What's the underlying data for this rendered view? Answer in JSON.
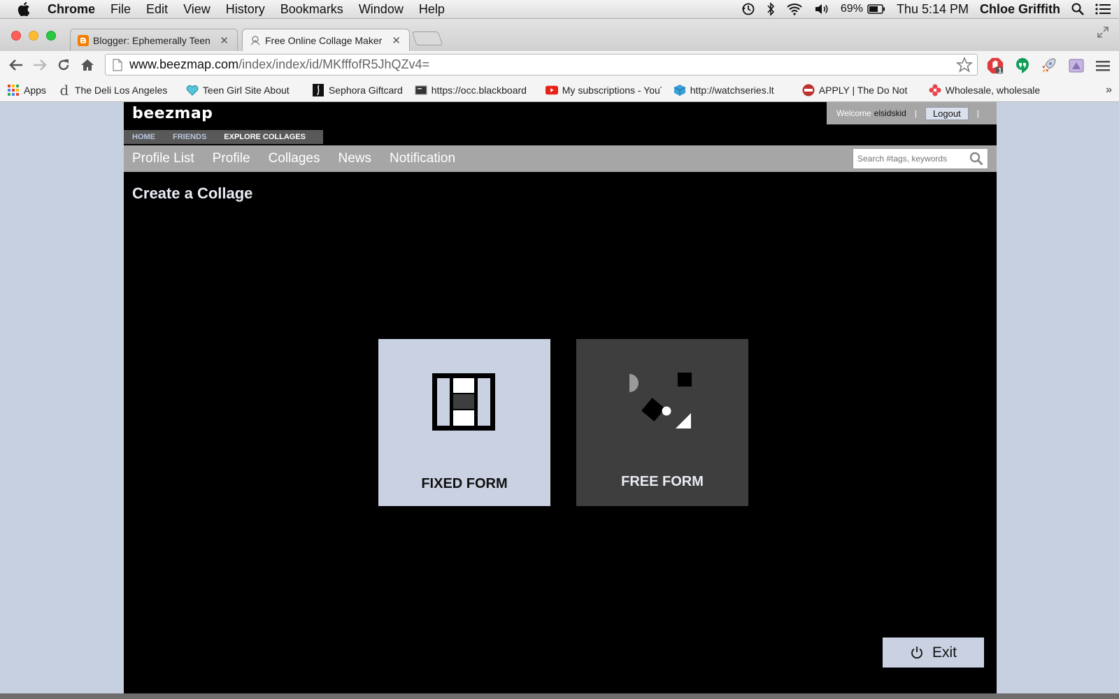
{
  "menubar": {
    "app_name": "Chrome",
    "items": [
      "File",
      "Edit",
      "View",
      "History",
      "Bookmarks",
      "Window",
      "Help"
    ],
    "battery": "69%",
    "clock": "Thu 5:14 PM",
    "user": "Chloe Griffith"
  },
  "tabs": [
    {
      "title": "Blogger: Ephemerally Teen",
      "icon": "blogger-icon",
      "active": false
    },
    {
      "title": "Free Online Collage Maker",
      "icon": "beezmap-icon",
      "active": true
    }
  ],
  "toolbar": {
    "url_host": "www.beezmap.com",
    "url_path": "/index/index/id/MKfffofR5JhQZv4=",
    "extension_badge": "1"
  },
  "bookmarks": [
    {
      "label": "Apps",
      "icon": "apps-grid-icon"
    },
    {
      "label": "The Deli Los Angeles",
      "icon": "deli-icon"
    },
    {
      "label": "Teen Girl Site About",
      "icon": "heart-icon"
    },
    {
      "label": "Sephora Giftcard",
      "icon": "sephora-icon"
    },
    {
      "label": "https://occ.blackboard",
      "icon": "blackboard-icon"
    },
    {
      "label": "My subscriptions - YouTube",
      "icon": "youtube-icon"
    },
    {
      "label": "http://watchseries.lt",
      "icon": "cube-icon"
    },
    {
      "label": "APPLY | The Do Not",
      "icon": "apply-icon"
    },
    {
      "label": "Wholesale, wholesale",
      "icon": "flower-icon"
    }
  ],
  "site": {
    "brand": "beezmap",
    "welcome_label": "Welcome",
    "username": "elsidskid",
    "logout_label": "Logout",
    "top_nav": [
      "HOME",
      "FRIENDS",
      "EXPLORE COLLAGES"
    ],
    "sub_nav": [
      "Profile List",
      "Profile",
      "Collages",
      "News",
      "Notification"
    ],
    "search_placeholder": "Search #tags, keywords",
    "page_title": "Create a Collage",
    "fixed_form_label": "FIXED FORM",
    "free_form_label": "FREE FORM",
    "exit_label": "Exit"
  },
  "colors": {
    "card_light": "#c9d1e2",
    "card_dark": "#3e3e3e",
    "page_bg": "#000000",
    "nav_gray": "#a6a6a6"
  }
}
